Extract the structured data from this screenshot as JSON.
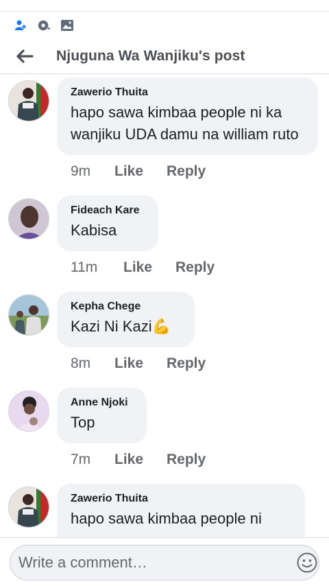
{
  "header": {
    "title": "Njuguna Wa Wanjiku's post"
  },
  "comments": [
    {
      "author": "Zawerio Thuita",
      "text": "hapo sawa kimbaa people  ni ka wanjiku  UDA damu na william ruto",
      "time": "9m",
      "like": "Like",
      "reply": "Reply"
    },
    {
      "author": "Fideach Kare",
      "text": "Kabisa",
      "time": "11m",
      "like": "Like",
      "reply": "Reply"
    },
    {
      "author": "Kepha Chege",
      "text": "Kazi Ni Kazi",
      "emoji": "💪",
      "time": "8m",
      "like": "Like",
      "reply": "Reply"
    },
    {
      "author": "Anne Njoki",
      "text": "Top",
      "time": "7m",
      "like": "Like",
      "reply": "Reply"
    },
    {
      "author": "Zawerio Thuita",
      "text": "hapo sawa kimbaa people  ni"
    }
  ],
  "composer": {
    "placeholder": "Write a comment…"
  },
  "icons": {
    "back": "arrow-left-icon",
    "friend_request": "friend-request-icon",
    "messenger": "messenger-icon",
    "photo": "photo-icon",
    "emoji": "emoji-icon"
  },
  "colors": {
    "accent": "#1877f2",
    "bubble": "#f0f2f5",
    "secondary_text": "#65676b"
  }
}
